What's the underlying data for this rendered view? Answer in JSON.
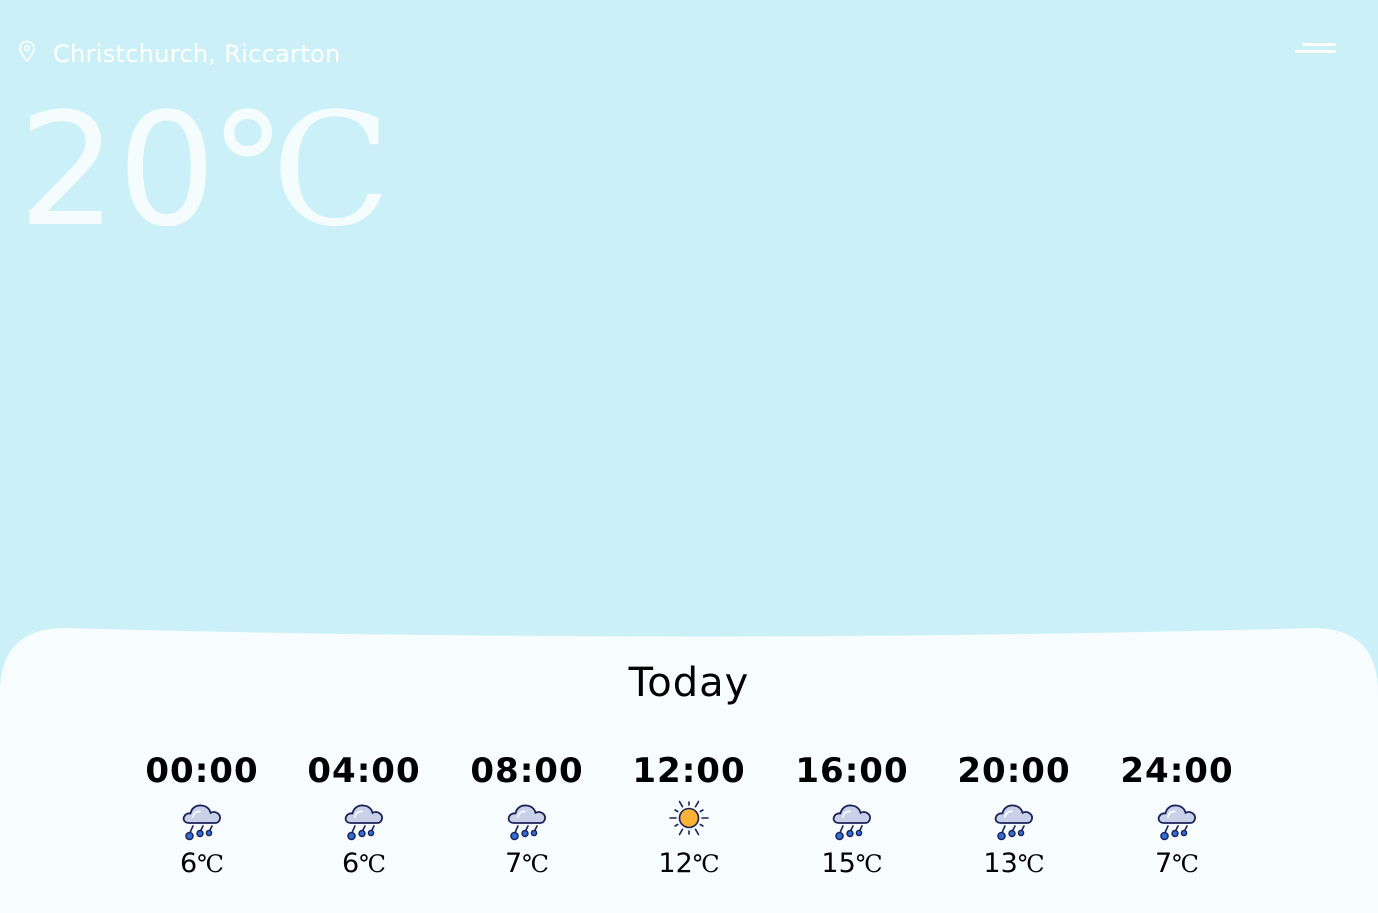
{
  "header": {
    "location": "Christchurch, Riccarton",
    "location_icon": "map-pin-icon",
    "menu_icon": "menu-icon"
  },
  "current": {
    "temperature": "20",
    "unit": "℃"
  },
  "forecast": {
    "title": "Today",
    "hours": [
      {
        "time": "00:00",
        "icon": "rain-cloud-icon",
        "temp": "6",
        "unit": "℃"
      },
      {
        "time": "04:00",
        "icon": "rain-cloud-icon",
        "temp": "6",
        "unit": "℃"
      },
      {
        "time": "08:00",
        "icon": "rain-cloud-icon",
        "temp": "7",
        "unit": "℃"
      },
      {
        "time": "12:00",
        "icon": "sun-icon",
        "temp": "12",
        "unit": "℃"
      },
      {
        "time": "16:00",
        "icon": "rain-cloud-icon",
        "temp": "15",
        "unit": "℃"
      },
      {
        "time": "20:00",
        "icon": "rain-cloud-icon",
        "temp": "13",
        "unit": "℃"
      },
      {
        "time": "24:00",
        "icon": "rain-cloud-icon",
        "temp": "7",
        "unit": "℃"
      }
    ]
  },
  "colors": {
    "sky": "#cbf0f7",
    "panel": "#f7fcfe",
    "sun": "#f9b233",
    "rain": "#2f6fd6",
    "cloud": "#c9d1e8",
    "outline": "#1b2259"
  }
}
